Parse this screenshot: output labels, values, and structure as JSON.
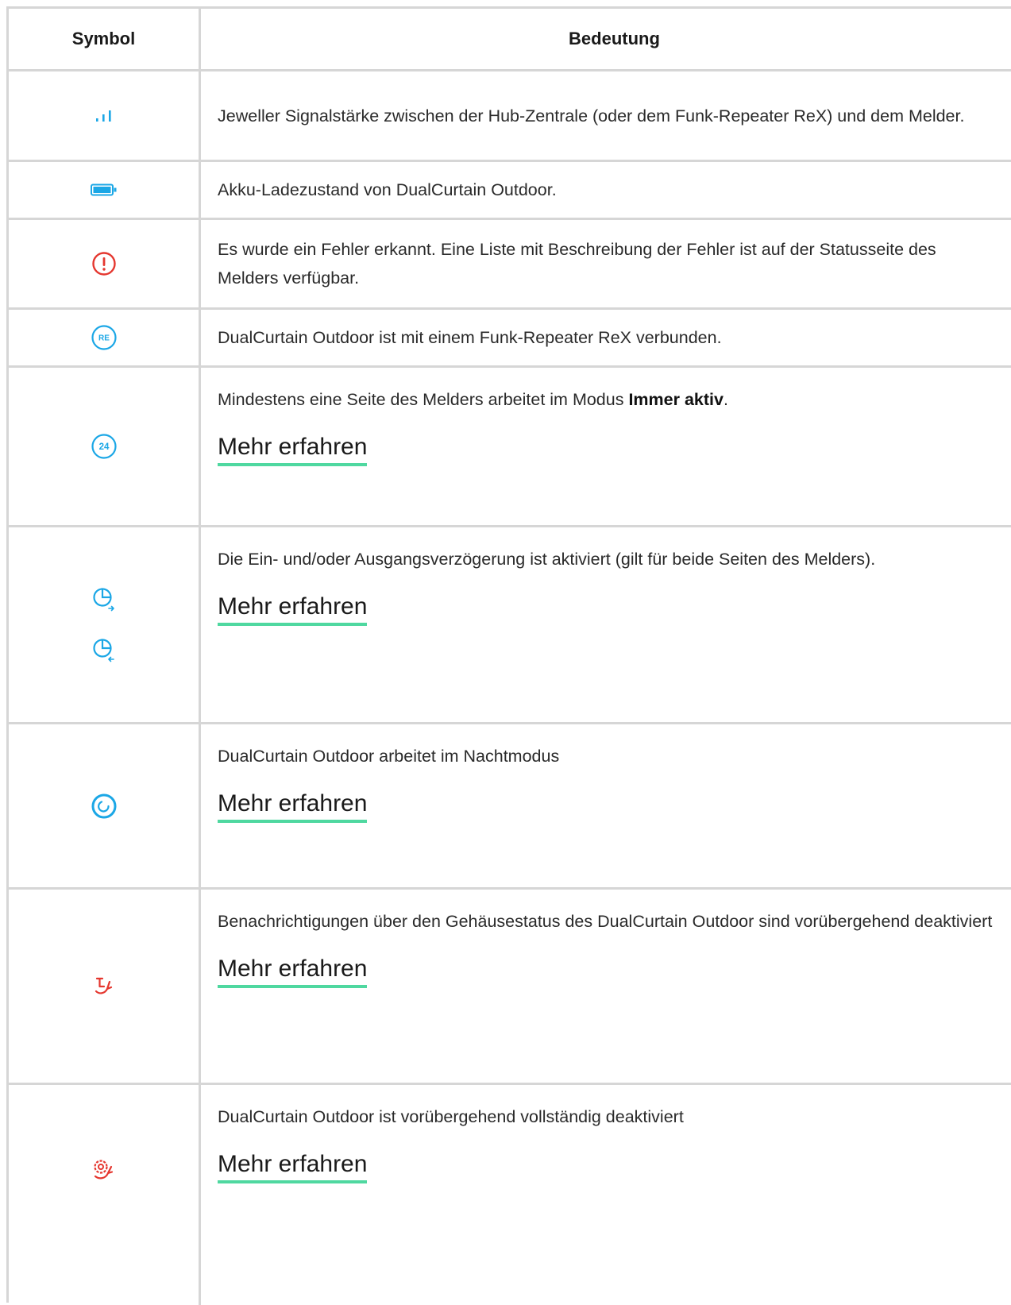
{
  "header": {
    "symbol": "Symbol",
    "meaning": "Bedeutung"
  },
  "rows": [
    {
      "icon": "signal-strength-icon",
      "text": "Jeweller Signalstärke zwischen der Hub-Zentrale (oder dem Funk-Repeater ReX) und dem Melder."
    },
    {
      "icon": "battery-icon",
      "text": "Akku-Ladezustand von DualCurtain Outdoor."
    },
    {
      "icon": "error-icon",
      "text": "Es wurde ein Fehler erkannt. Eine Liste mit Beschreibung der Fehler ist auf der Statusseite des Melders verfügbar."
    },
    {
      "icon": "repeater-re-icon",
      "text": "DualCurtain Outdoor ist mit einem Funk-Repeater ReX verbunden."
    },
    {
      "icon": "always-active-24-icon",
      "text_pre": "Mindestens eine Seite des Melders arbeitet im Modus ",
      "text_bold": "Immer aktiv",
      "text_post": ".",
      "link": "Mehr erfahren"
    },
    {
      "icon": "delay-icons",
      "text": "Die Ein- und/oder Ausgangsverzögerung ist aktiviert (gilt für beide Seiten des Melders).",
      "link": "Mehr erfahren"
    },
    {
      "icon": "night-mode-icon",
      "text": "DualCurtain Outdoor arbeitet im Nachtmodus",
      "link": "Mehr erfahren"
    },
    {
      "icon": "tamper-disabled-icon",
      "text": "Benachrichtigungen über den Gehäusestatus des DualCurtain Outdoor sind vorübergehend deaktiviert",
      "link": "Mehr erfahren"
    },
    {
      "icon": "device-disabled-icon",
      "text": "DualCurtain Outdoor ist vorübergehend vollständig deaktiviert",
      "link": "Mehr erfahren"
    }
  ],
  "colors": {
    "blue": "#1ba7e6",
    "red": "#e5372f",
    "link_underline": "#4fd8a0",
    "border": "#d6d6d6"
  }
}
